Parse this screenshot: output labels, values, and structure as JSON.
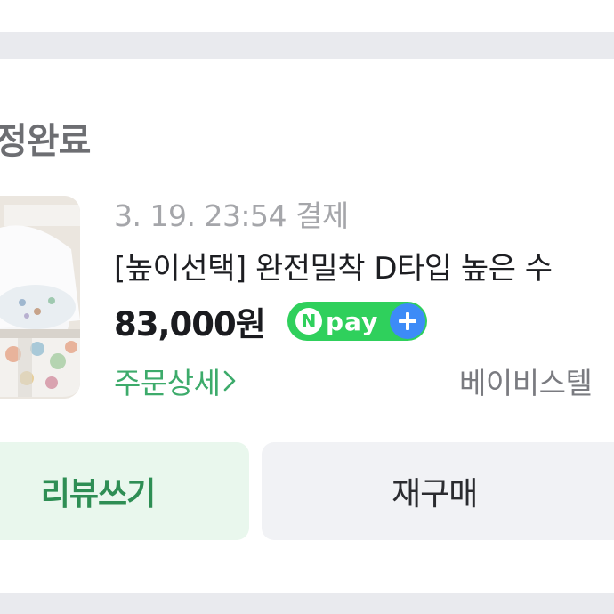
{
  "order": {
    "status": "정완료",
    "date": "3. 19. 23:54 결제",
    "title": "[높이선택] 완전밀착 D타입 높은 수",
    "price": "83,000원",
    "npay": {
      "n": "N",
      "label": "pay",
      "plus": "+"
    },
    "detail_link": "주문상세",
    "seller": "베이비스텔"
  },
  "buttons": {
    "review": "리뷰쓰기",
    "rebuy": "재구매"
  },
  "colors": {
    "npay_green": "#2fd05c",
    "link_green": "#3dab6b",
    "review_bg": "#e9f7ed",
    "plus_blue": "#3d8bf7"
  }
}
